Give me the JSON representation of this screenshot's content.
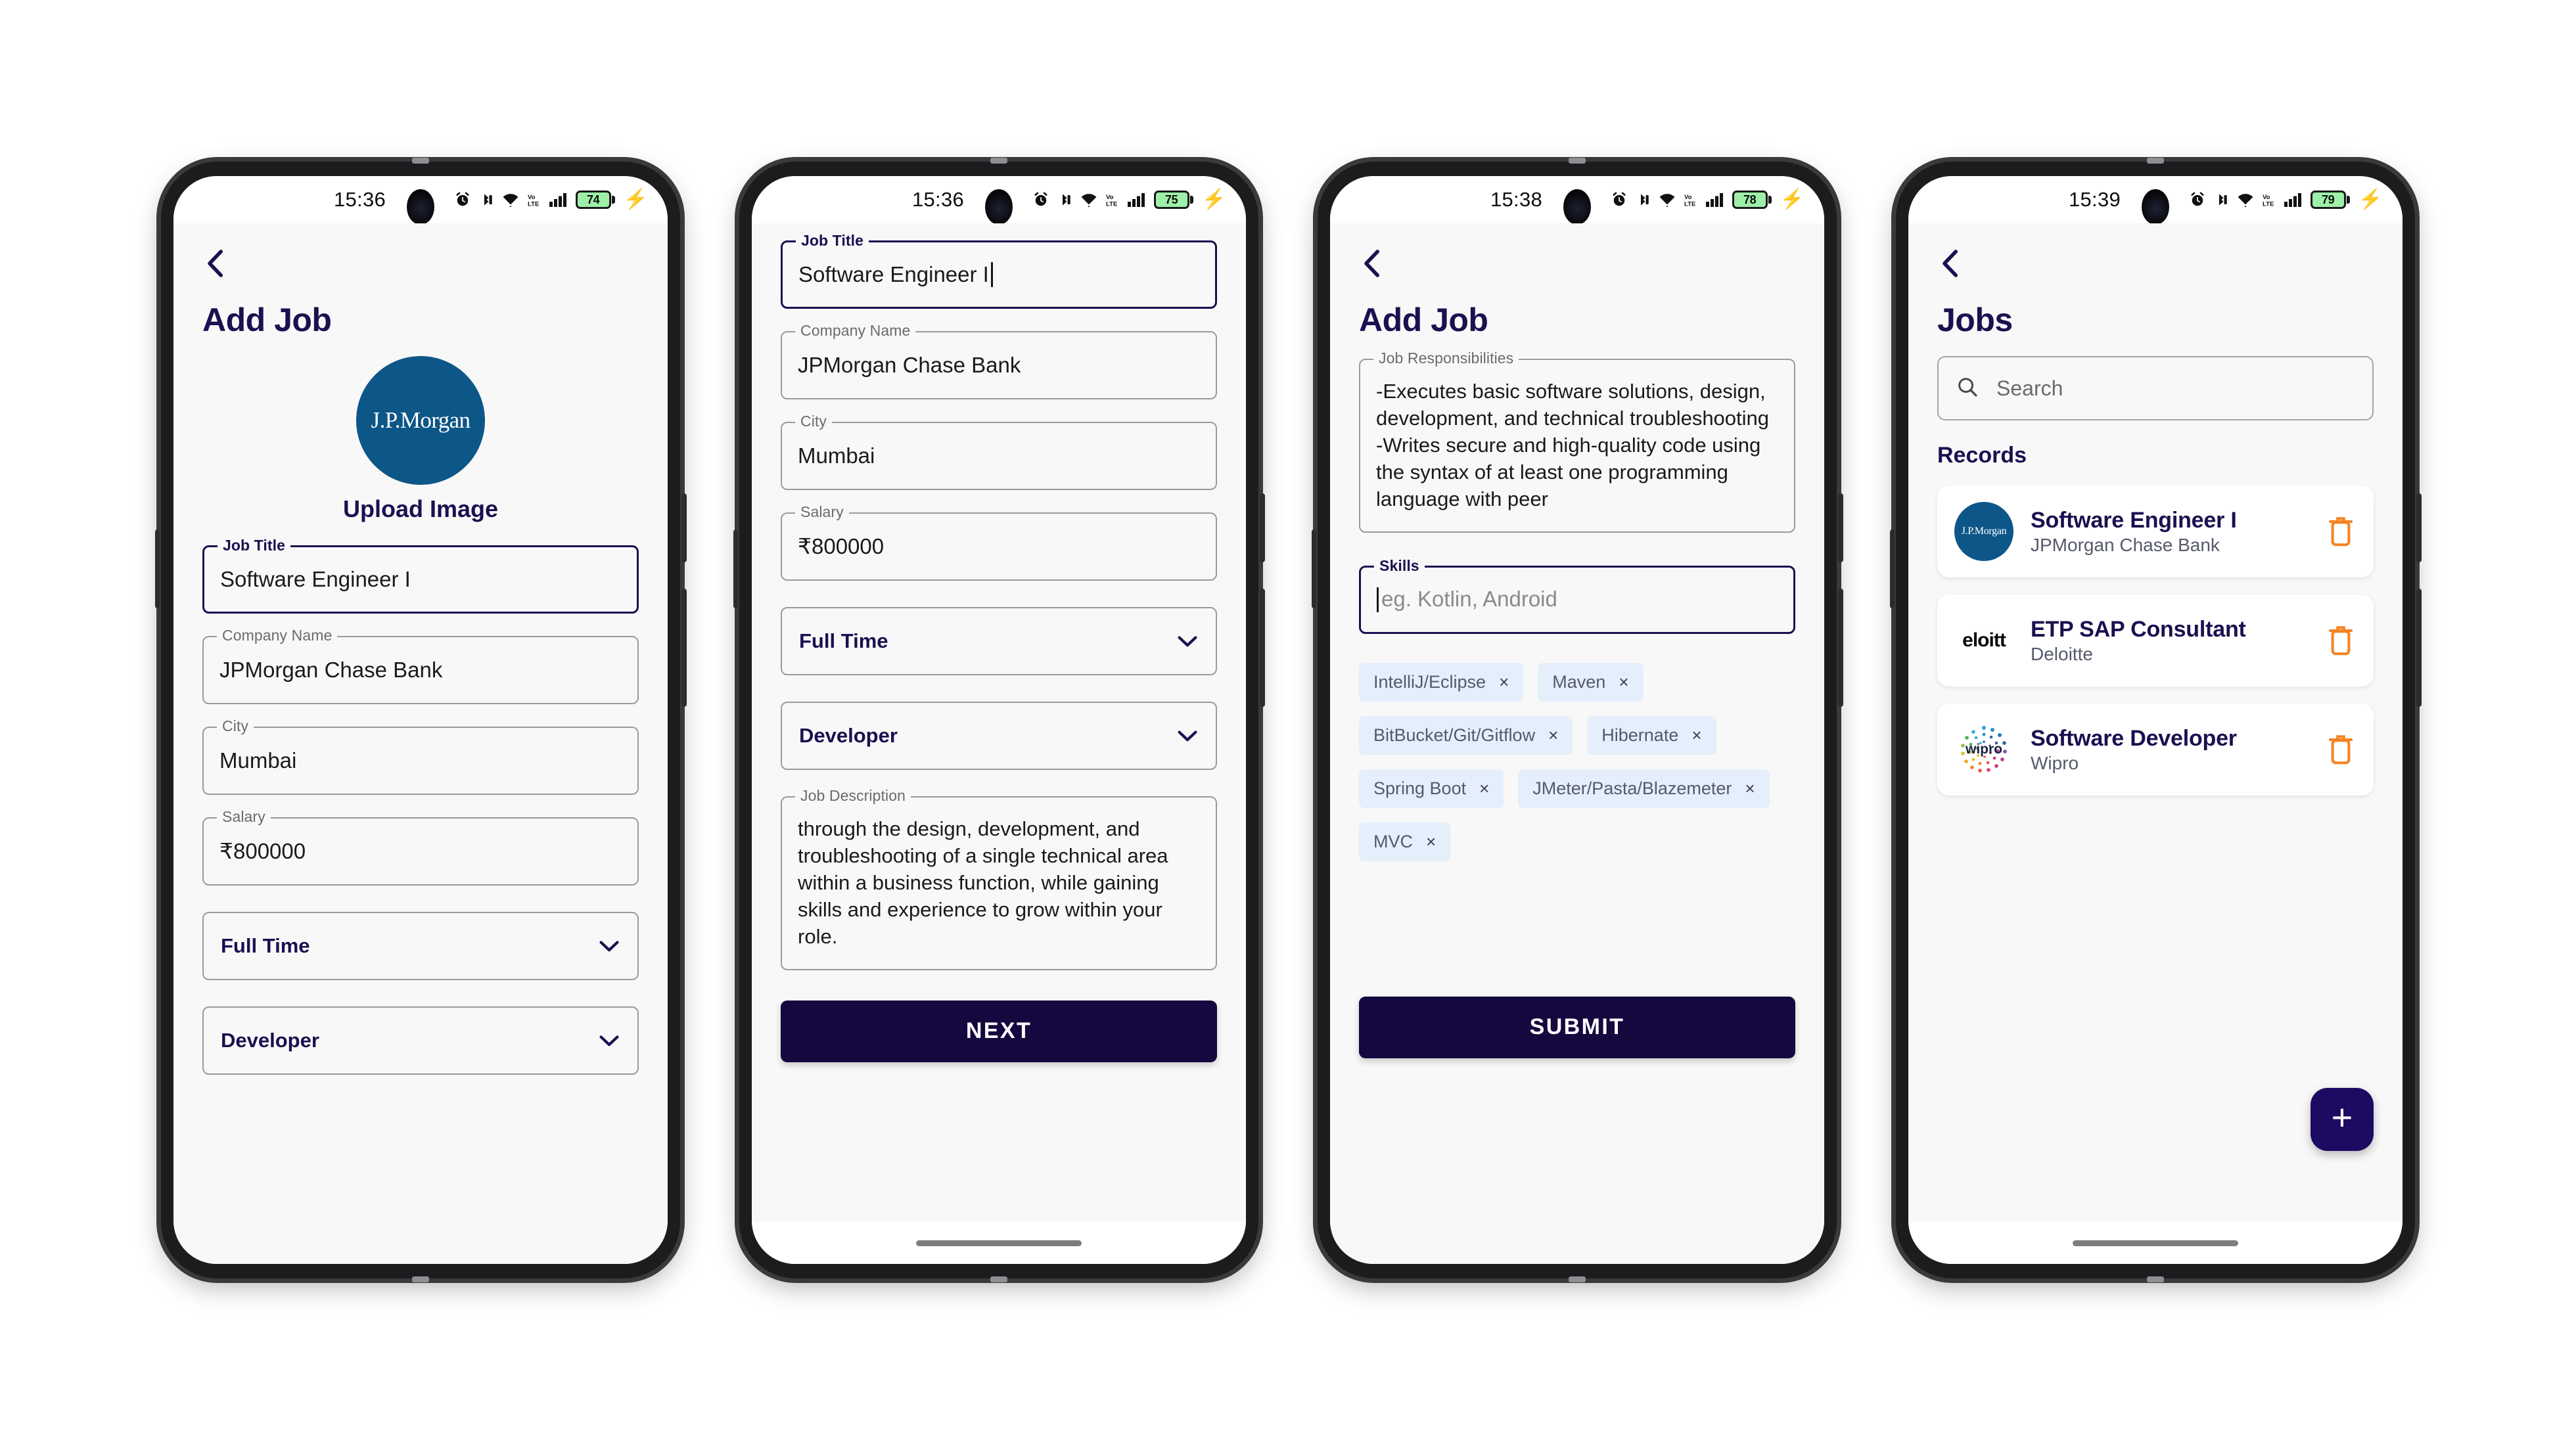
{
  "phones": [
    {
      "id": "phone-add-job-step1",
      "status": {
        "time": "15:36",
        "battery": "74",
        "icons": [
          "alarm-icon",
          "bluetooth-icon",
          "wifi-icon",
          "volte-icon",
          "signal-icon",
          "battery-icon",
          "charging-bolt-icon"
        ]
      },
      "screen_title": "Add Job",
      "upload": {
        "logo_text": "J.P.Morgan",
        "label": "Upload Image"
      },
      "fields": [
        {
          "legend": "Job Title",
          "value": "Software Engineer I",
          "focused": true
        },
        {
          "legend": "Company Name",
          "value": "JPMorgan Chase Bank",
          "focused": false
        },
        {
          "legend": "City",
          "value": "Mumbai",
          "focused": false
        },
        {
          "legend": "Salary",
          "value": "₹800000",
          "focused": false
        }
      ],
      "dropdowns": [
        {
          "value": "Full Time"
        },
        {
          "value": "Developer"
        }
      ]
    },
    {
      "id": "phone-add-job-step1-scrolled",
      "status": {
        "time": "15:36",
        "battery": "75"
      },
      "fields": [
        {
          "legend": "Job Title",
          "value": "Software Engineer I",
          "focused": true,
          "caret": true
        },
        {
          "legend": "Company Name",
          "value": "JPMorgan Chase Bank",
          "focused": false
        },
        {
          "legend": "City",
          "value": "Mumbai",
          "focused": false
        },
        {
          "legend": "Salary",
          "value": "₹800000",
          "focused": false
        }
      ],
      "dropdowns": [
        {
          "value": "Full Time"
        },
        {
          "value": "Developer"
        }
      ],
      "description": {
        "legend": "Job Description",
        "value": "through the design, development, and troubleshooting of a single technical area within a business function, while gaining skills and experience to grow within your role."
      },
      "next_button": "NEXT"
    },
    {
      "id": "phone-add-job-step2",
      "status": {
        "time": "15:38",
        "battery": "78"
      },
      "screen_title": "Add Job",
      "responsibilities": {
        "legend": "Job Responsibilities",
        "value": "-Executes basic software solutions, design, development, and technical troubleshooting\n-Writes secure and high-quality code using the syntax of at least one programming language with peer"
      },
      "skills_field": {
        "legend": "Skills",
        "placeholder": "eg. Kotlin, Android",
        "value": "",
        "focused": true
      },
      "skill_chips": [
        "IntelliJ/Eclipse",
        "Maven",
        "BitBucket/Git/Gitflow",
        "Hibernate",
        "Spring Boot",
        "JMeter/Pasta/Blazemeter",
        "MVC"
      ],
      "submit_button": "SUBMIT"
    },
    {
      "id": "phone-jobs-list",
      "status": {
        "time": "15:39",
        "battery": "79"
      },
      "screen_title": "Jobs",
      "search": {
        "placeholder": "Search",
        "value": ""
      },
      "section_label": "Records",
      "records": [
        {
          "title": "Software Engineer I",
          "company": "JPMorgan Chase Bank",
          "logo": "jpmorgan-logo",
          "logo_text": "J.P.Morgan"
        },
        {
          "title": "ETP SAP Consultant",
          "company": "Deloitte",
          "logo": "deloitte-logo",
          "logo_text": "eloitt"
        },
        {
          "title": "Software Developer",
          "company": "Wipro",
          "logo": "wipro-logo",
          "logo_text": "wipro"
        }
      ],
      "fab_label": "+"
    }
  ],
  "colors": {
    "primary": "#1b1050",
    "button": "#15083f",
    "fab": "#1d0a63",
    "chip_bg": "#e4effb",
    "trash": "#f58220",
    "jpm_blue": "#0d5688",
    "battery_green": "#9ef0a8"
  }
}
